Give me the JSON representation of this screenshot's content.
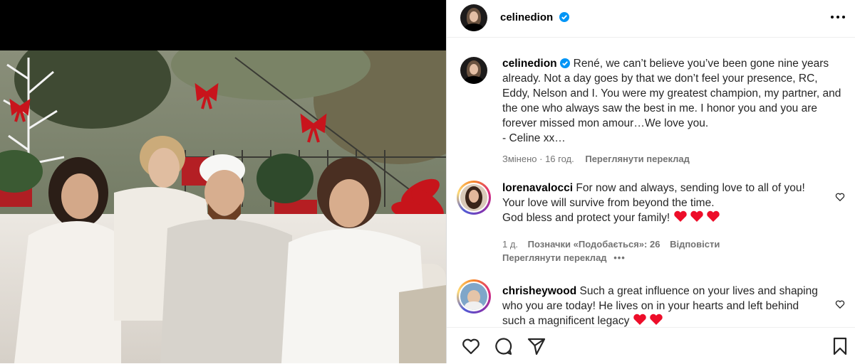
{
  "post": {
    "author": "celinedion",
    "caption_text": "René, we can’t believe you’ve been gone nine years already. Not a day goes by that we don’t feel your presence, RC, Eddy, Nelson and I. You were my greatest champion, my partner, and the one who always saw the best in me. I honor you and you are forever missed mon amour…We love you.\n- Celine xx…",
    "edited_label": "Змінено",
    "time_ago": "16 год.",
    "translate_label": "Переглянути переклад"
  },
  "comments": [
    {
      "user": "lorenavalocci",
      "line1": "For now and always, sending love to all of you!",
      "line2": "Your love will survive from beyond the time.",
      "line3": "God bless and protect your family!",
      "time_ago": "1 д.",
      "likes_label": "Позначки «Подобається»: 26",
      "reply_label": "Відповісти",
      "translate_label": "Переглянути переклад",
      "more_icon": "ellipsis-icon"
    },
    {
      "user": "chrisheywood",
      "text": "Such a great influence on your lives and shaping who you are today! He lives on in your hearts and left behind such a magnificent legacy"
    }
  ],
  "icons": {
    "verified": "verified-badge-icon",
    "more": "more-options-icon",
    "like": "heart-icon",
    "comment": "comment-icon",
    "share": "share-icon",
    "save": "bookmark-icon"
  },
  "colors": {
    "verified": "#0095f6",
    "heart": "#ed0d29",
    "meta": "#737373"
  }
}
